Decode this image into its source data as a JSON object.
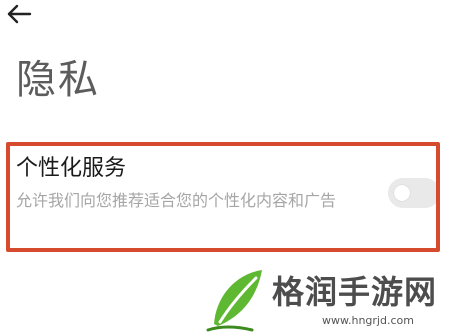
{
  "navigation": {
    "back_icon": "arrow-left-icon"
  },
  "page": {
    "title": "隐私"
  },
  "settings": {
    "personalized_service": {
      "title": "个性化服务",
      "description": "允许我们向您推荐适合您的个性化内容和广告",
      "enabled": false
    }
  },
  "highlight": {
    "color": "#d64a2e"
  },
  "watermark": {
    "text": "格润手游网",
    "url": "www.hngrjd.com",
    "logo_icon": "leaf-logo-icon"
  }
}
